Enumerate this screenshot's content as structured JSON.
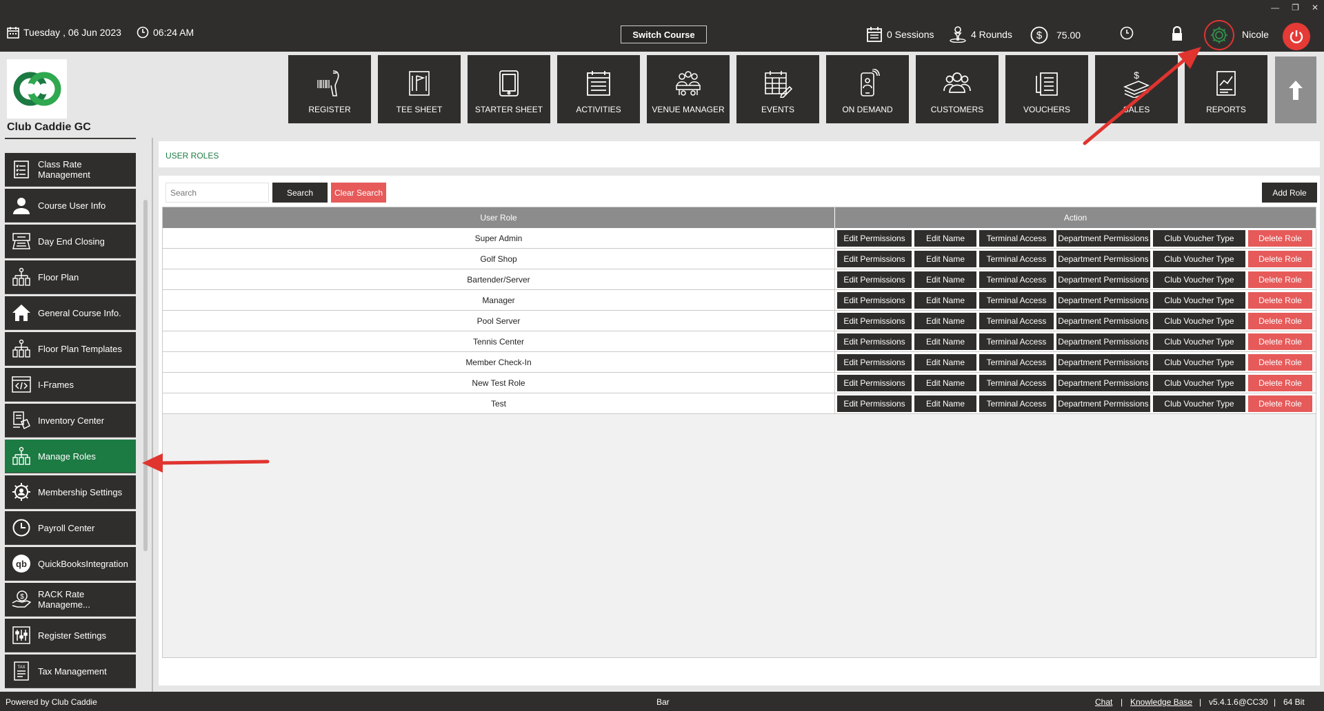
{
  "topbar": {
    "date": "Tuesday ,  06 Jun 2023",
    "time": "06:24 AM",
    "switch_course": "Switch Course",
    "sessions": "0 Sessions",
    "rounds": "4 Rounds",
    "balance": "75.00",
    "user": "Nicole"
  },
  "club": {
    "name": "Club Caddie GC"
  },
  "nav": [
    {
      "label": "REGISTER",
      "icon": "barcode-scanner-icon"
    },
    {
      "label": "TEE SHEET",
      "icon": "flag-sheet-icon"
    },
    {
      "label": "STARTER SHEET",
      "icon": "tablet-icon"
    },
    {
      "label": "ACTIVITIES",
      "icon": "calendar-list-icon"
    },
    {
      "label": "VENUE MANAGER",
      "icon": "meeting-icon"
    },
    {
      "label": "EVENTS",
      "icon": "calendar-edit-icon"
    },
    {
      "label": "ON DEMAND",
      "icon": "mobile-icon"
    },
    {
      "label": "CUSTOMERS",
      "icon": "users-icon"
    },
    {
      "label": "VOUCHERS",
      "icon": "voucher-icon"
    },
    {
      "label": "SALES",
      "icon": "sales-icon"
    },
    {
      "label": "REPORTS",
      "icon": "report-icon"
    }
  ],
  "sidebar": {
    "items": [
      {
        "label": "Class Rate Management"
      },
      {
        "label": "Course User Info"
      },
      {
        "label": "Day End Closing"
      },
      {
        "label": "Floor Plan"
      },
      {
        "label": "General Course Info."
      },
      {
        "label": "Floor Plan Templates"
      },
      {
        "label": "I-Frames"
      },
      {
        "label": "Inventory Center"
      },
      {
        "label": "Manage Roles"
      },
      {
        "label": "Membership Settings"
      },
      {
        "label": "Payroll Center"
      },
      {
        "label": "QuickBooksIntegration"
      },
      {
        "label": "RACK Rate Manageme..."
      },
      {
        "label": "Register Settings"
      },
      {
        "label": "Tax Management"
      }
    ]
  },
  "breadcrumb": "USER ROLES",
  "search": {
    "placeholder": "Search",
    "search_btn": "Search",
    "clear_btn": "Clear Search",
    "add_btn": "Add Role"
  },
  "table": {
    "col_role": "User Role",
    "col_action": "Action",
    "actions": [
      "Edit Permissions",
      "Edit Name",
      "Terminal Access",
      "Department Permissions",
      "Club Voucher Type",
      "Delete Role"
    ],
    "rows": [
      "Super Admin",
      "Golf Shop",
      "Bartender/Server",
      "Manager",
      "Pool Server",
      "Tennis Center",
      "Member Check-In",
      "New Test Role",
      "Test"
    ]
  },
  "footer": {
    "powered": "Powered by Club Caddie",
    "terminal": "Bar",
    "chat": "Chat",
    "kb": "Knowledge Base",
    "version": "v5.4.1.6@CC30",
    "bits": "64 Bit"
  },
  "colors": {
    "dark": "#302e2c",
    "active_green": "#1c7a43",
    "delete_red": "#e65a5a",
    "power_red": "#e53a36",
    "annotation_red": "#e0342f"
  }
}
